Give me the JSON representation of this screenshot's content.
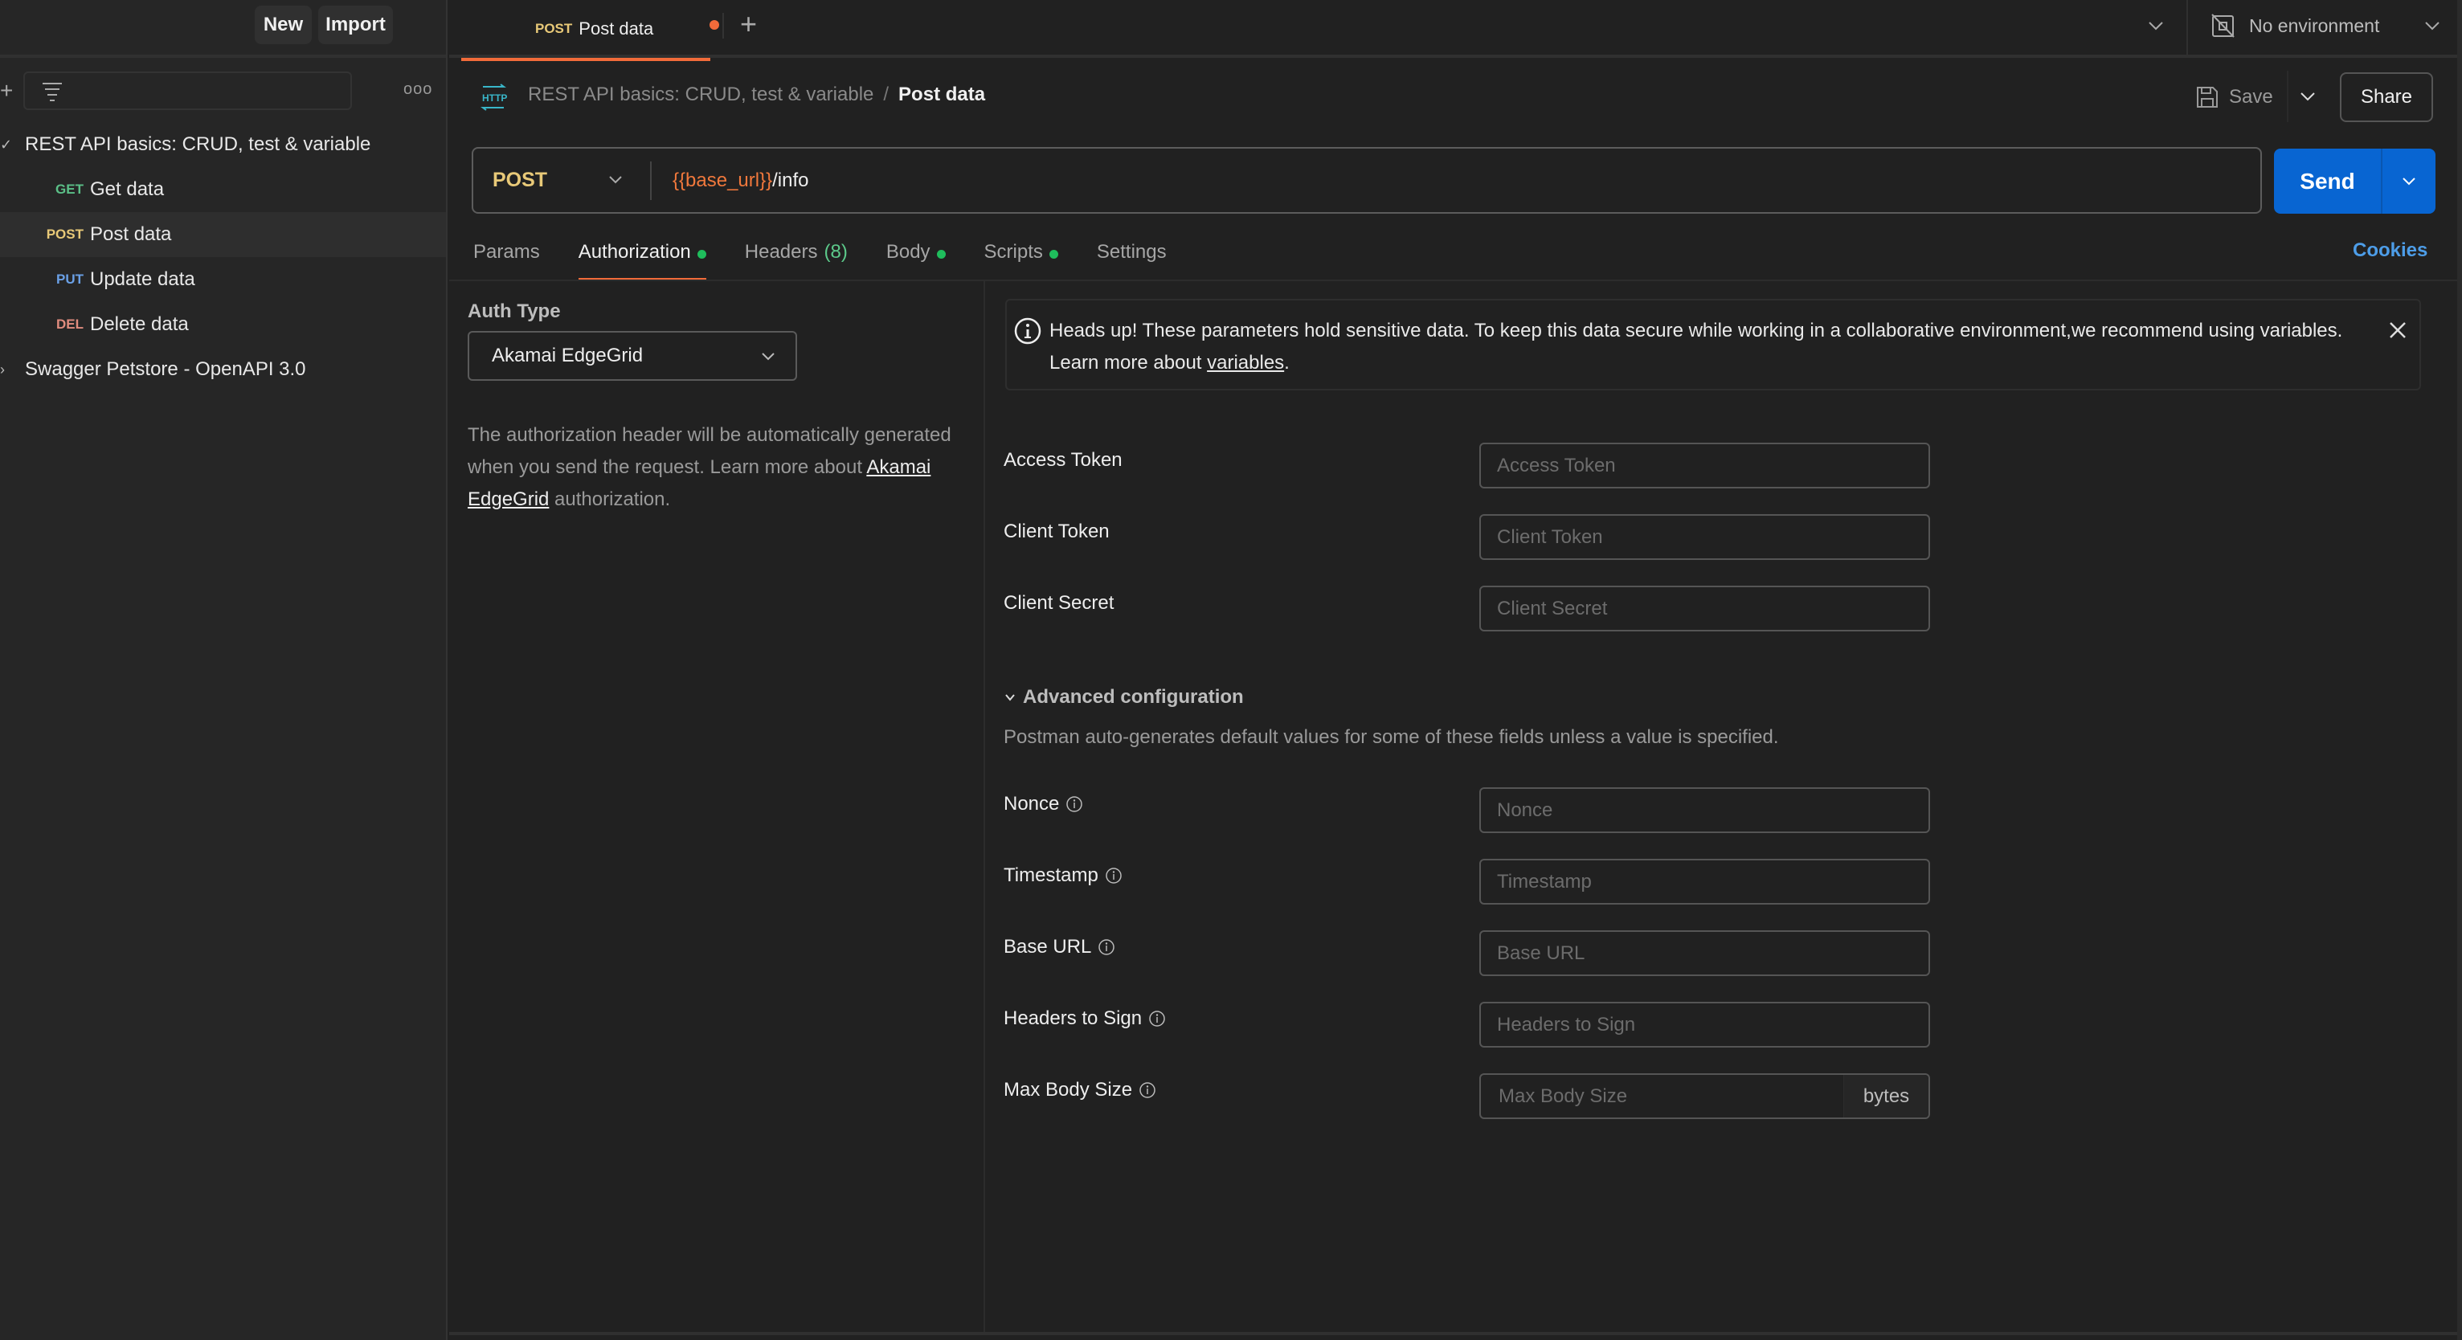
{
  "sidebar": {
    "new_label": "New",
    "import_label": "Import",
    "more_label": "ooo",
    "plus_label": "+",
    "collections": [
      {
        "name": "REST API basics: CRUD, test & variable",
        "expanded": true,
        "caret": "✓",
        "requests": [
          {
            "method": "GET",
            "name": "Get data"
          },
          {
            "method": "POST",
            "name": "Post data",
            "active": true
          },
          {
            "method": "PUT",
            "name": "Update data"
          },
          {
            "method": "DEL",
            "name": "Delete data"
          }
        ]
      },
      {
        "name": "Swagger Petstore - OpenAPI 3.0",
        "expanded": false,
        "caret": "›"
      }
    ]
  },
  "tabbar": {
    "active_tab": {
      "method": "POST",
      "name": "Post data",
      "unsaved": true
    },
    "add_label": "+",
    "environment": "No environment"
  },
  "request": {
    "breadcrumb": {
      "collection": "REST API basics: CRUD, test & variable",
      "separator": "/",
      "request": "Post data"
    },
    "save_label": "Save",
    "share_label": "Share",
    "method": "POST",
    "url_variable": "{{base_url}}",
    "url_path": "/info",
    "send_label": "Send",
    "tabs": [
      {
        "label": "Params"
      },
      {
        "label": "Authorization",
        "dot": true,
        "active": true
      },
      {
        "label": "Headers",
        "count": "(8)"
      },
      {
        "label": "Body",
        "dot": true
      },
      {
        "label": "Scripts",
        "dot": true
      },
      {
        "label": "Settings"
      }
    ],
    "cookies_label": "Cookies"
  },
  "auth": {
    "type_label": "Auth Type",
    "type_value": "Akamai EdgeGrid",
    "desc_before": "The authorization header will be automatically generated when you send the request. Learn more about ",
    "desc_link": "Akamai EdgeGrid",
    "desc_after": " authorization.",
    "banner": {
      "text": "Heads up! These parameters hold sensitive data. To keep this data secure while working in a collaborative environment,we recommend using variables. Learn more about ",
      "link": "variables",
      "end": "."
    },
    "fields": [
      {
        "label": "Access Token",
        "placeholder": "Access Token",
        "value": ""
      },
      {
        "label": "Client Token",
        "placeholder": "Client Token",
        "value": ""
      },
      {
        "label": "Client Secret",
        "placeholder": "Client Secret",
        "value": ""
      }
    ],
    "advanced": {
      "label": "Advanced configuration",
      "description": "Postman auto-generates default values for some of these fields unless a value is specified.",
      "fields": [
        {
          "label": "Nonce",
          "placeholder": "Nonce",
          "value": ""
        },
        {
          "label": "Timestamp",
          "placeholder": "Timestamp",
          "value": ""
        },
        {
          "label": "Base URL",
          "placeholder": "Base URL",
          "value": ""
        },
        {
          "label": "Headers to Sign",
          "placeholder": "Headers to Sign",
          "value": ""
        },
        {
          "label": "Max Body Size",
          "placeholder": "Max Body Size",
          "value": "",
          "suffix": "bytes"
        }
      ]
    }
  },
  "colors": {
    "accent": "#f26b3a",
    "send": "#0865d2",
    "get": "#5bbf87",
    "post": "#e8c978",
    "put": "#6aa0e6",
    "del": "#e08c7e",
    "status_dot": "#1fbd5c",
    "link": "#4d9de8"
  }
}
